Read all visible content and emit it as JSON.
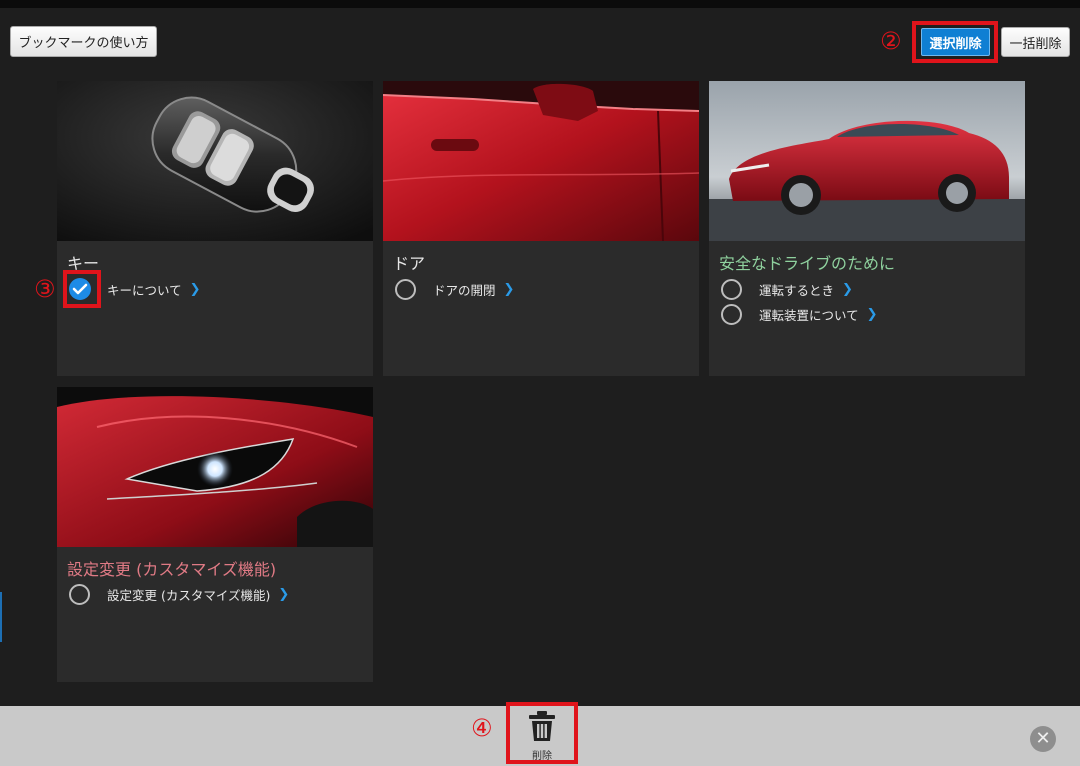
{
  "toolbar": {
    "howto_label": "ブックマークの使い方",
    "select_delete_label": "選択削除",
    "bulk_delete_label": "一括削除"
  },
  "markers": {
    "m2": "②",
    "m3": "③",
    "m4": "④"
  },
  "cards": [
    {
      "title": "キー",
      "title_color": "#e6e6e6",
      "photo": "smart-key",
      "items": [
        {
          "label": "キーについて",
          "checked": true
        }
      ]
    },
    {
      "title": "ドア",
      "title_color": "#e6e6e6",
      "photo": "car-door",
      "items": [
        {
          "label": "ドアの開閉",
          "checked": false
        }
      ]
    },
    {
      "title": "安全なドライブのために",
      "title_color": "#8fd19e",
      "photo": "red-sedan",
      "items": [
        {
          "label": "運転するとき",
          "checked": false
        },
        {
          "label": "運転装置について",
          "checked": false
        }
      ]
    },
    {
      "title": "設定変更 (カスタマイズ機能)",
      "title_color": "#e07a85",
      "photo": "headlight",
      "items": [
        {
          "label": "設定変更 (カスタマイズ機能)",
          "checked": false
        }
      ]
    }
  ],
  "bottom": {
    "delete_label": "削除",
    "close_icon": "close-icon",
    "trash_icon": "trash-icon"
  },
  "colors": {
    "accent_blue": "#0f7fd3",
    "highlight_red": "#e0141b",
    "chevron_blue": "#2a9be8"
  }
}
